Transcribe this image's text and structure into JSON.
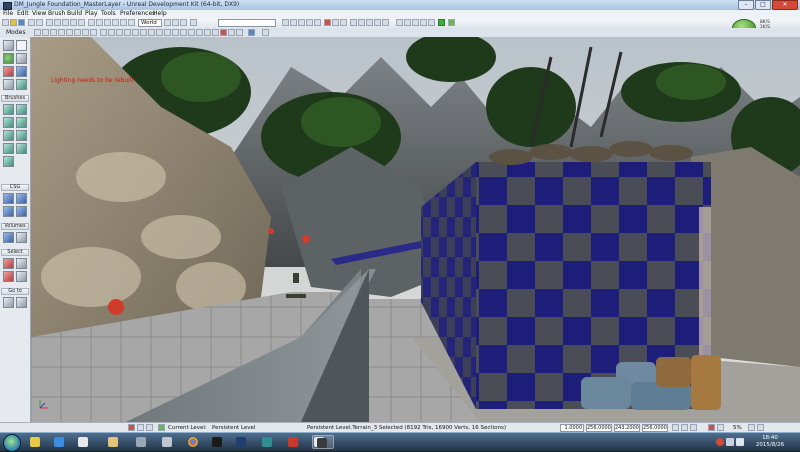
{
  "window": {
    "title": "DM_Jungle Foundation_MasterLayer - Unreal Development Kit (64-bit, DX9)",
    "min_label": "–",
    "max_label": "□",
    "close_label": "✕"
  },
  "menu": {
    "items": [
      "File",
      "Edit",
      "View",
      "Brush",
      "Build",
      "Play",
      "Tools",
      "Preferences",
      "Help"
    ]
  },
  "toolbar": {
    "mode_select": "World",
    "search_value": ""
  },
  "stats": {
    "line1": "8K/S",
    "line2": "1K/S"
  },
  "leftpanel": {
    "modes_label": "Modes",
    "brushes_label": "Brushes",
    "csg_label": "CSG",
    "volumes_label": "Volumes",
    "select_label": "Select",
    "go_label": "Go to"
  },
  "viewport": {
    "overlay_text": "Lighting needs to be rebuilt",
    "colors": {
      "checker_dark": "#1d1d7a",
      "checker_light": "#4a4c56",
      "sky": "#cdd3d8",
      "rock": "#8c8579",
      "floor": "#9ea0a3"
    }
  },
  "statusbar": {
    "current_level_label": "Current Level:",
    "current_level_value": "Persistent Level",
    "selection_info": "Persistent Level.Terrain_3 Selected (8192 Tris, 16900 Verts, 16 Sections)",
    "fields": [
      "1.0000",
      "256.0000",
      "243.2000",
      "256.0000"
    ],
    "zoom": "5%"
  },
  "taskbar": {
    "time": "18:40",
    "date": "2015/8/26"
  }
}
